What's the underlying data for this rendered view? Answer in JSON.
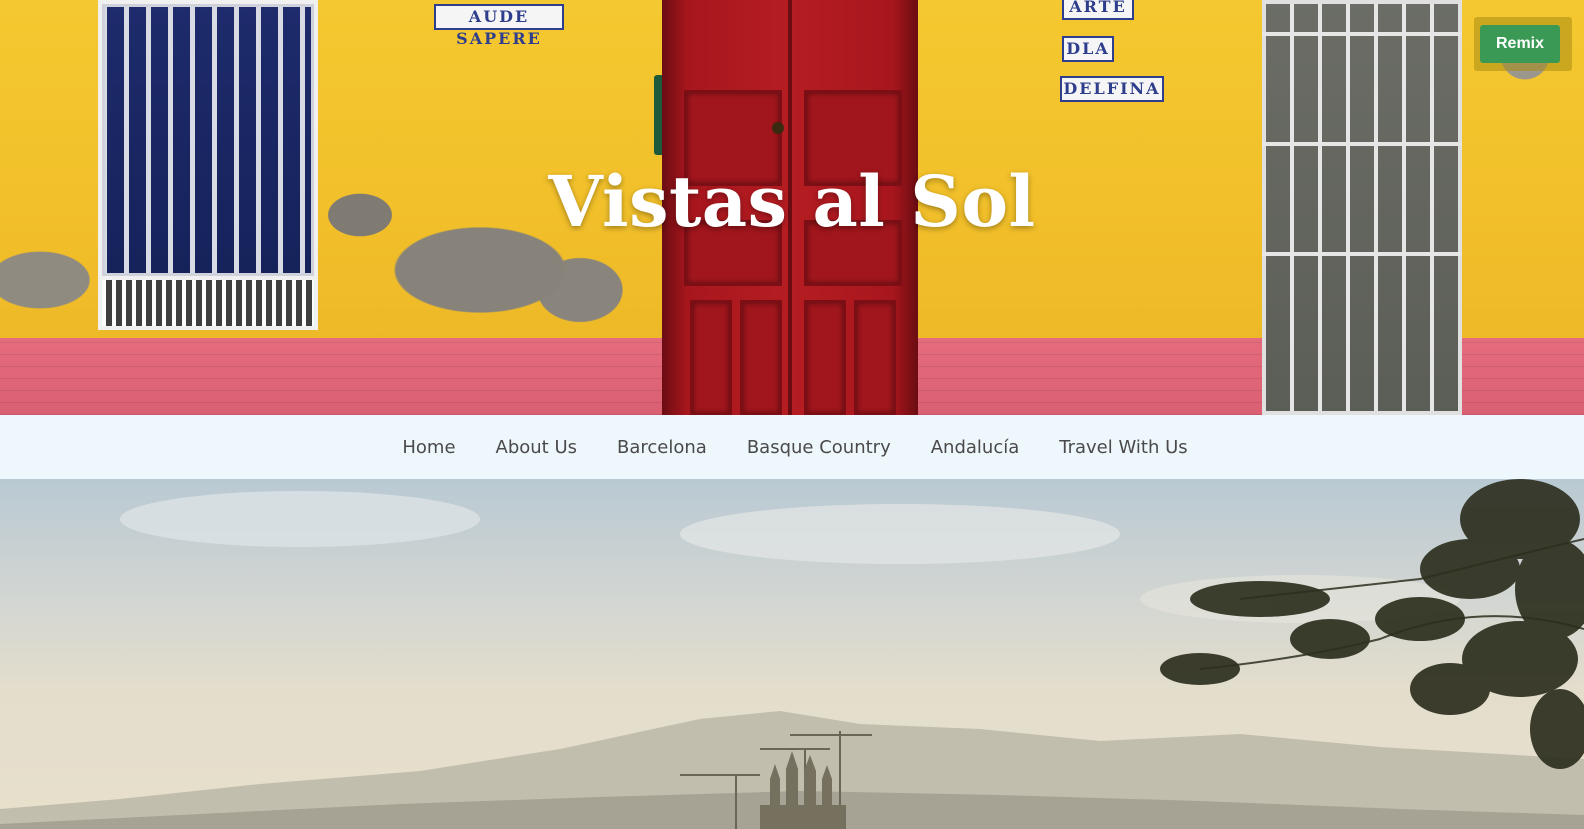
{
  "site": {
    "title": "Vistas al Sol"
  },
  "hero": {
    "tiles": [
      "AUDE SAPERE",
      "ARTE",
      "DLA",
      "DELFINA"
    ]
  },
  "remix": {
    "label": "Remix"
  },
  "nav": {
    "items": [
      {
        "label": "Home"
      },
      {
        "label": "About Us"
      },
      {
        "label": "Barcelona"
      },
      {
        "label": "Basque Country"
      },
      {
        "label": "Andalucía"
      },
      {
        "label": "Travel With Us"
      }
    ]
  },
  "colors": {
    "nav_background": "#eef7fc",
    "remix_button": "#3a9a55",
    "wall_yellow": "#f2c331",
    "door_red": "#b51d22"
  }
}
